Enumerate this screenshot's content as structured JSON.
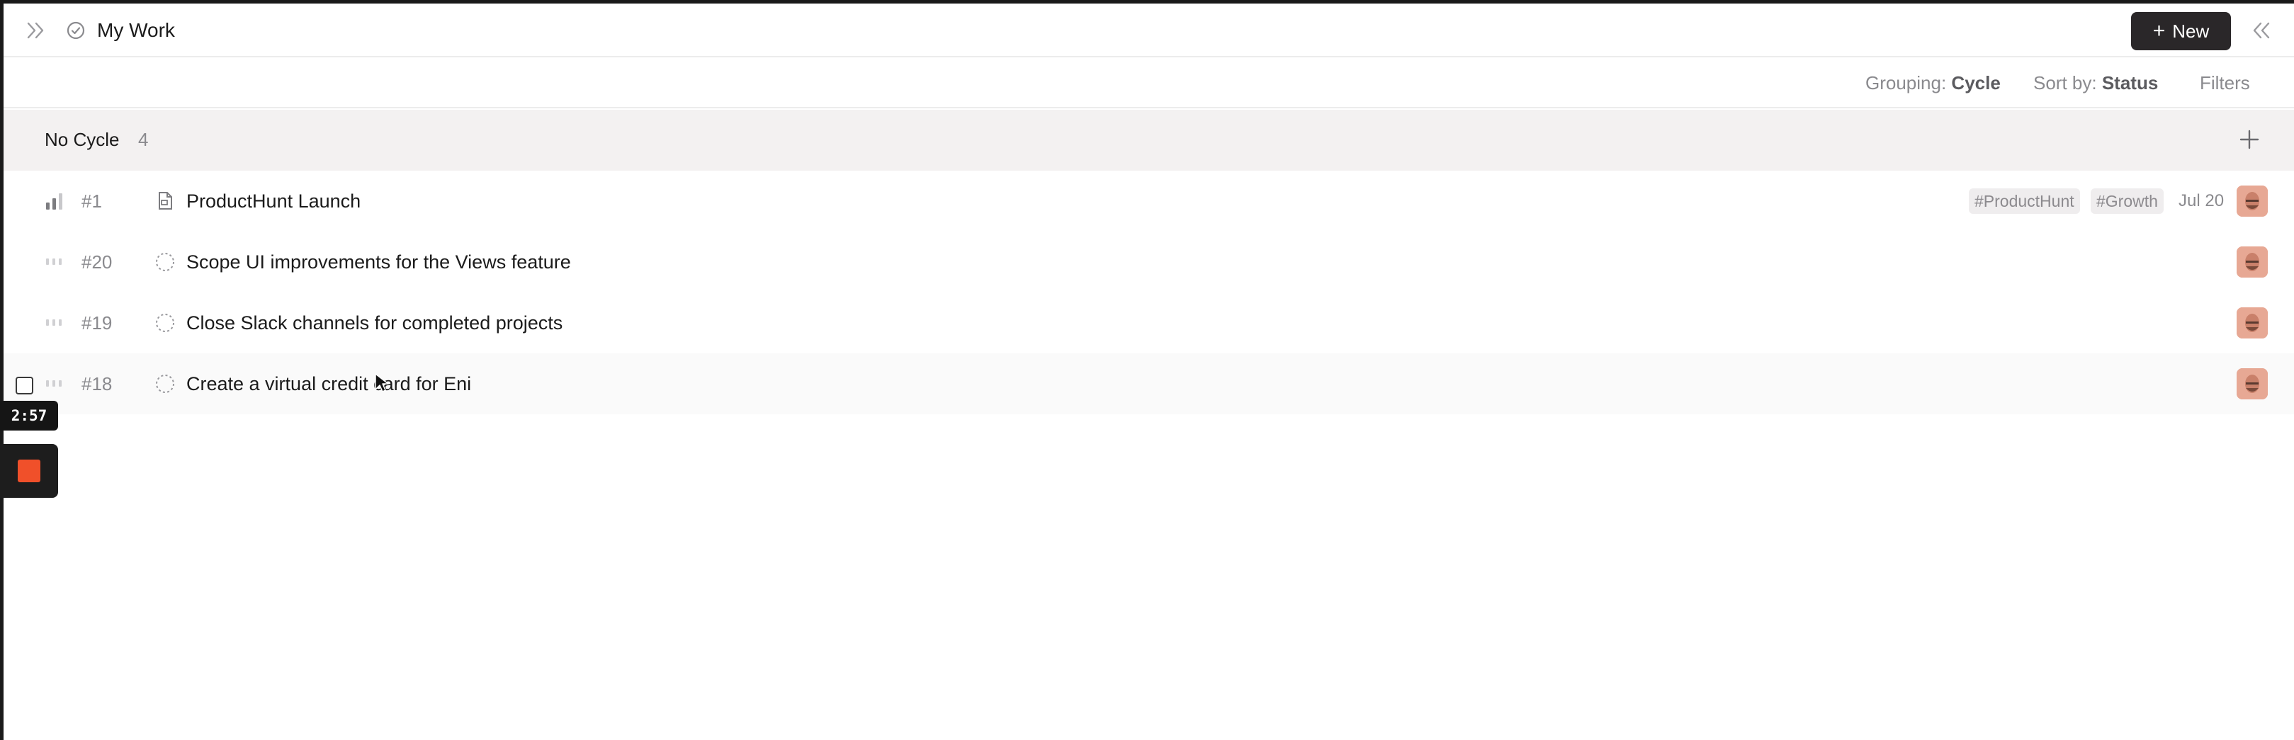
{
  "header": {
    "title": "My Work",
    "new_button_label": "New"
  },
  "toolbar": {
    "grouping_label": "Grouping:",
    "grouping_value": "Cycle",
    "sort_label": "Sort by:",
    "sort_value": "Status",
    "filters_label": "Filters"
  },
  "group": {
    "name": "No Cycle",
    "count": "4"
  },
  "issues": [
    {
      "number": "#1",
      "title": "ProductHunt Launch",
      "priority": "medium",
      "status": "draft",
      "tags": [
        "#ProductHunt",
        "#Growth"
      ],
      "due": "Jul 20"
    },
    {
      "number": "#20",
      "title": "Scope UI improvements for the Views feature",
      "priority": "none",
      "status": "backlog",
      "tags": [],
      "due": ""
    },
    {
      "number": "#19",
      "title": "Close Slack channels for completed projects",
      "priority": "none",
      "status": "backlog",
      "tags": [],
      "due": ""
    },
    {
      "number": "#18",
      "title": "Create a virtual credit card for Eni",
      "priority": "none",
      "status": "backlog",
      "tags": [],
      "due": ""
    }
  ],
  "recording": {
    "timer": "2:57"
  },
  "colors": {
    "accent_dark": "#2a2729",
    "group_bg": "#f3f1f1",
    "record_stop": "#f0502a",
    "avatar": "#e7a894"
  }
}
